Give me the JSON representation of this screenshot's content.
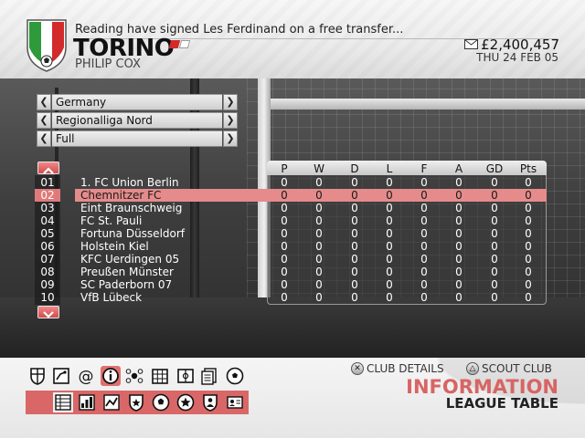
{
  "header": {
    "news": "Reading have signed Les Ferdinand on a free transfer...",
    "club_name": "TORINO",
    "manager": "PHILIP COX",
    "balance": "£2,400,457",
    "date": "THU 24 FEB 05",
    "crest_colors": [
      "#2e9a3a",
      "#ffffff",
      "#d32b2b"
    ]
  },
  "selectors": [
    {
      "name": "country",
      "value": "Germany"
    },
    {
      "name": "league",
      "value": "Regionalliga Nord"
    },
    {
      "name": "view",
      "value": "Full"
    }
  ],
  "table": {
    "columns": [
      "P",
      "W",
      "D",
      "L",
      "F",
      "A",
      "GD",
      "Pts"
    ],
    "selected_index": 1,
    "rows": [
      {
        "pos": "01",
        "team": "1. FC Union Berlin",
        "stats": [
          "0",
          "0",
          "0",
          "0",
          "0",
          "0",
          "0",
          "0"
        ]
      },
      {
        "pos": "02",
        "team": "Chemnitzer FC",
        "stats": [
          "0",
          "0",
          "0",
          "0",
          "0",
          "0",
          "0",
          "0"
        ]
      },
      {
        "pos": "03",
        "team": "Eint Braunschweig",
        "stats": [
          "0",
          "0",
          "0",
          "0",
          "0",
          "0",
          "0",
          "0"
        ]
      },
      {
        "pos": "04",
        "team": "FC St. Pauli",
        "stats": [
          "0",
          "0",
          "0",
          "0",
          "0",
          "0",
          "0",
          "0"
        ]
      },
      {
        "pos": "05",
        "team": "Fortuna Düsseldorf",
        "stats": [
          "0",
          "0",
          "0",
          "0",
          "0",
          "0",
          "0",
          "0"
        ]
      },
      {
        "pos": "06",
        "team": "Holstein Kiel",
        "stats": [
          "0",
          "0",
          "0",
          "0",
          "0",
          "0",
          "0",
          "0"
        ]
      },
      {
        "pos": "07",
        "team": "KFC Uerdingen 05",
        "stats": [
          "0",
          "0",
          "0",
          "0",
          "0",
          "0",
          "0",
          "0"
        ]
      },
      {
        "pos": "08",
        "team": "Preußen Münster",
        "stats": [
          "0",
          "0",
          "0",
          "0",
          "0",
          "0",
          "0",
          "0"
        ]
      },
      {
        "pos": "09",
        "team": "SC Paderborn 07",
        "stats": [
          "0",
          "0",
          "0",
          "0",
          "0",
          "0",
          "0",
          "0"
        ]
      },
      {
        "pos": "10",
        "team": "VfB Lübeck",
        "stats": [
          "0",
          "0",
          "0",
          "0",
          "0",
          "0",
          "0",
          "0"
        ]
      }
    ]
  },
  "footer": {
    "club_details_label": "CLUB DETAILS",
    "scout_club_label": "SCOUT CLUB",
    "club_details_button_icon": "cross-button-icon",
    "scout_club_button_icon": "triangle-button-icon",
    "screen_title": "INFORMATION",
    "screen_subtitle": "LEAGUE TABLE",
    "accent_color": "#d86464",
    "nav_icons": [
      "shield-icon",
      "tactics-board-icon",
      "at-mail-icon",
      "info-icon",
      "ball-network-icon",
      "calendar-grid-icon",
      "pitch-icon",
      "documents-icon",
      "football-icon"
    ],
    "nav_selected_index": 3,
    "sub_icons": [
      "league-table-icon",
      "bar-stats-icon",
      "line-graph-icon",
      "shield-star-icon",
      "ball-icon",
      "star-ball-icon",
      "shield-person-icon",
      "id-card-icon"
    ],
    "sub_selected_index": 0
  }
}
